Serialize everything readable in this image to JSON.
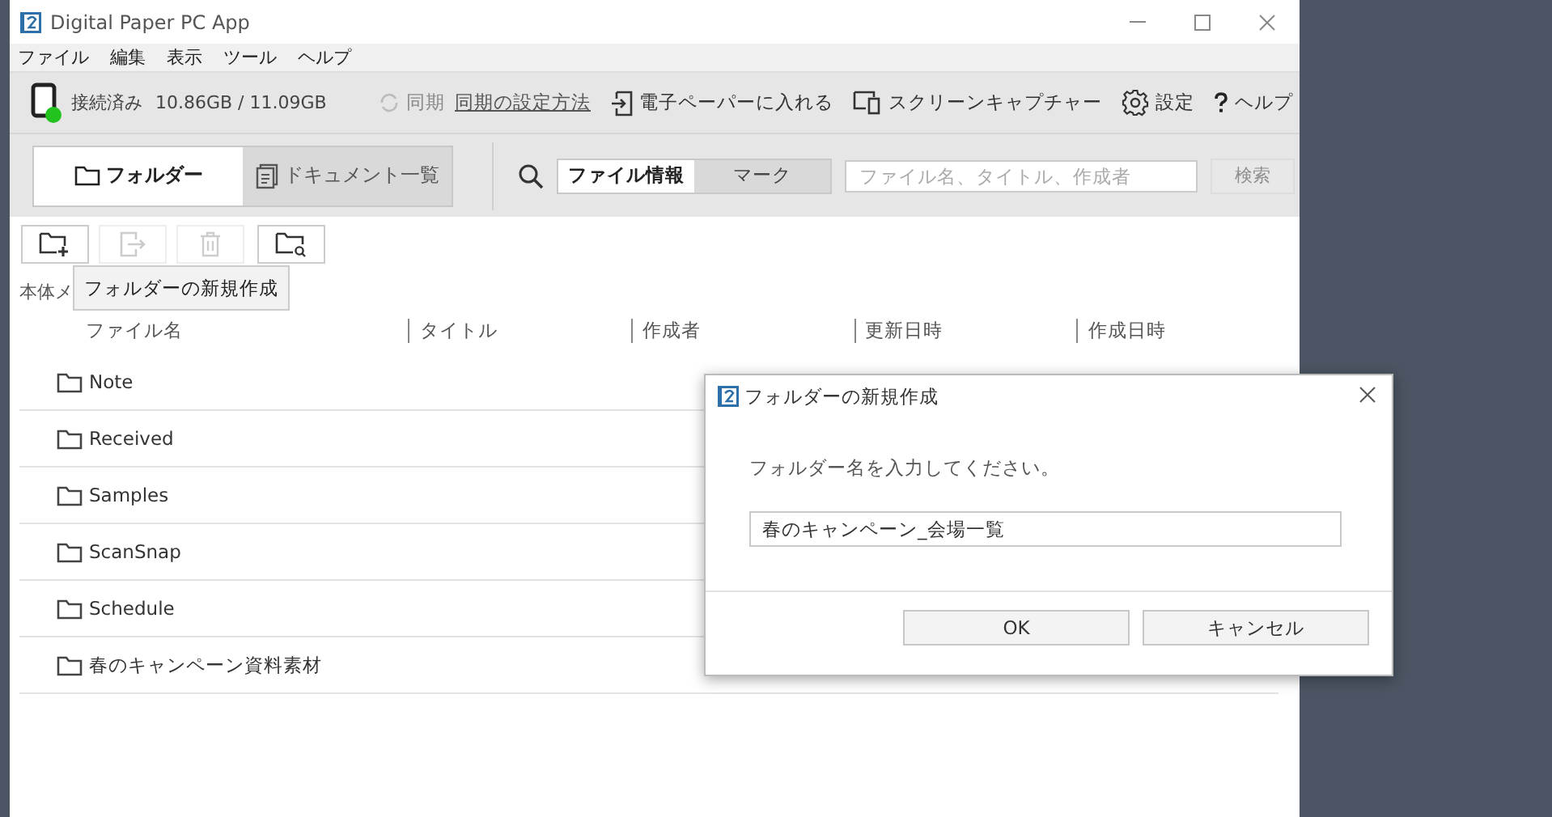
{
  "window": {
    "title": "Digital Paper PC App"
  },
  "menu": [
    "ファイル",
    "編集",
    "表示",
    "ツール",
    "ヘルプ"
  ],
  "status": {
    "connected": true,
    "connection": "接続済み",
    "storage": "10.86GB / 11.09GB"
  },
  "toolbar": [
    {
      "kind": "sync",
      "label": "同期",
      "disabled": true
    },
    {
      "kind": "link",
      "label": "同期の設定方法",
      "disabled": false
    },
    {
      "kind": "import",
      "label": "電子ペーパーに入れる",
      "disabled": false
    },
    {
      "kind": "capture",
      "label": "スクリーンキャプチャー",
      "disabled": false
    },
    {
      "kind": "settings",
      "label": "設定",
      "disabled": false
    },
    {
      "kind": "help",
      "label": "ヘルプ",
      "disabled": false
    }
  ],
  "view_tabs": [
    {
      "kind": "folder",
      "label": "フォルダー",
      "selected": true
    },
    {
      "kind": "document",
      "label": "ドキュメント一覧",
      "selected": false
    }
  ],
  "search": {
    "scopes": [
      {
        "label": "ファイル情報",
        "selected": true
      },
      {
        "label": "マーク",
        "selected": false
      }
    ],
    "placeholder": "ファイル名、タイトル、作成者",
    "button": "検索",
    "button_disabled": true
  },
  "actions": [
    {
      "kind": "new-folder",
      "disabled": false
    },
    {
      "kind": "export",
      "disabled": true
    },
    {
      "kind": "delete",
      "disabled": true
    },
    {
      "kind": "folder-search",
      "disabled": false
    }
  ],
  "breadcrumb": "本体メ",
  "tooltip": "フォルダーの新規作成",
  "table": {
    "columns": [
      "ファイル名",
      "タイトル",
      "作成者",
      "更新日時",
      "作成日時"
    ],
    "rows": [
      {
        "name": "Note"
      },
      {
        "name": "Received"
      },
      {
        "name": "Samples"
      },
      {
        "name": "ScanSnap"
      },
      {
        "name": "Schedule"
      },
      {
        "name": "春のキャンペーン資料素材"
      }
    ]
  },
  "dialog": {
    "title": "フォルダーの新規作成",
    "prompt": "フォルダー名を入力してください。",
    "value": "春のキャンペーン_会場一覧",
    "buttons": [
      "OK",
      "キャンセル"
    ]
  }
}
